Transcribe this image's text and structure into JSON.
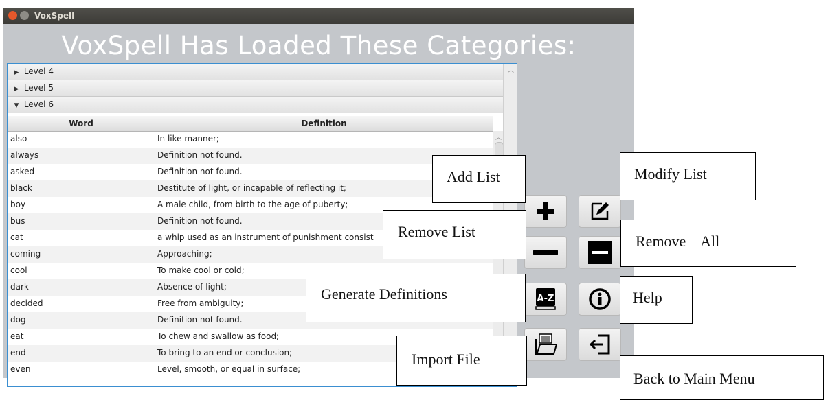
{
  "window": {
    "title": "VoxSpell"
  },
  "heading": "VoxSpell Has Loaded These Categories:",
  "tree": {
    "levels": [
      {
        "label": "Level 4",
        "expanded": false
      },
      {
        "label": "Level 5",
        "expanded": false
      },
      {
        "label": "Level 6",
        "expanded": true
      }
    ],
    "columns": [
      "Word",
      "Definition"
    ],
    "rows": [
      {
        "word": "also",
        "definition": "In like manner;"
      },
      {
        "word": "always",
        "definition": "Definition not found."
      },
      {
        "word": "asked",
        "definition": "Definition not found."
      },
      {
        "word": "black",
        "definition": "Destitute of light, or incapable of reflecting it;"
      },
      {
        "word": "boy",
        "definition": "A male child, from birth to the age of puberty;"
      },
      {
        "word": "bus",
        "definition": "Definition not found."
      },
      {
        "word": "cat",
        "definition": "a whip used as an instrument of punishment consist"
      },
      {
        "word": "coming",
        "definition": "Approaching;"
      },
      {
        "word": "cool",
        "definition": "To make cool or cold;"
      },
      {
        "word": "dark",
        "definition": "Absence of light;"
      },
      {
        "word": "decided",
        "definition": "Free from ambiguity;"
      },
      {
        "word": "dog",
        "definition": "Definition not found."
      },
      {
        "word": "eat",
        "definition": "To chew and swallow as food;"
      },
      {
        "word": "end",
        "definition": "To bring to an end or conclusion;"
      },
      {
        "word": "even",
        "definition": "Level, smooth, or equal in surface;"
      }
    ]
  },
  "buttons": {
    "add": {
      "icon": "plus-icon"
    },
    "modify": {
      "icon": "pencil-edit-icon"
    },
    "remove": {
      "icon": "minus-icon"
    },
    "remove_all": {
      "icon": "minus-box-icon"
    },
    "generate": {
      "icon": "a-z-book-icon"
    },
    "help": {
      "icon": "info-icon"
    },
    "import": {
      "icon": "folder-files-icon"
    },
    "back": {
      "icon": "exit-arrow-icon"
    }
  },
  "tooltips": {
    "add": "Add List",
    "modify": "Modify List",
    "remove": "Remove List",
    "remove_all": "Remove    All",
    "generate": "Generate Definitions",
    "help": "Help",
    "import": "Import File",
    "back": "Back to Main Menu"
  }
}
